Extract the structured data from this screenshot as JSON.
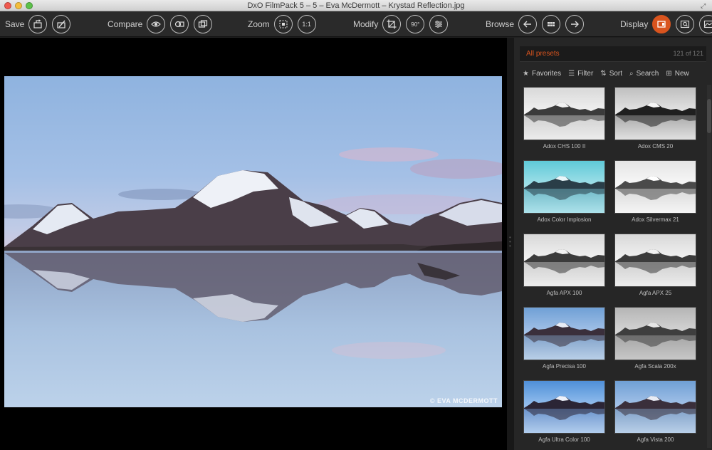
{
  "window": {
    "title": "DxO FilmPack 5 – 5 – Eva McDermott – Krystad Reflection.jpg"
  },
  "toolbar": {
    "save_label": "Save",
    "compare_label": "Compare",
    "zoom_label": "Zoom",
    "zoom_1to1": "1:1",
    "modify_label": "Modify",
    "rotate_90": "90°",
    "browse_label": "Browse",
    "display_label": "Display"
  },
  "viewer": {
    "watermark": "© EVA MCDERMOTT"
  },
  "presets": {
    "title": "All presets",
    "count": "121 of 121",
    "actions": {
      "favorites": "Favorites",
      "filter": "Filter",
      "sort": "Sort",
      "search": "Search",
      "new": "New"
    },
    "items": [
      {
        "label": "Adox CHS 100 II",
        "style": "bw"
      },
      {
        "label": "Adox CMS 20",
        "style": "bw-contrast"
      },
      {
        "label": "Adox Color Implosion",
        "style": "cyan"
      },
      {
        "label": "Adox Silvermax 21",
        "style": "bw-light"
      },
      {
        "label": "Agfa APX 100",
        "style": "bw"
      },
      {
        "label": "Agfa APX 25",
        "style": "bw"
      },
      {
        "label": "Agfa Precisa 100",
        "style": "color"
      },
      {
        "label": "Agfa Scala 200x",
        "style": "bw-gray"
      },
      {
        "label": "Agfa Ultra Color 100",
        "style": "color-vivid"
      },
      {
        "label": "Agfa Vista 200",
        "style": "color"
      }
    ]
  },
  "colors": {
    "accent": "#d9541e",
    "panel_bg": "#262626",
    "toolbar_bg": "#2a2a2a"
  }
}
